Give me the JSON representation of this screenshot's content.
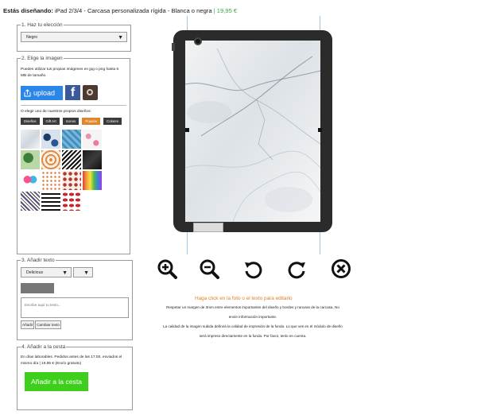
{
  "header": {
    "lead": "Estás diseñando:",
    "product": "iPad 2/3/4 - Carcasa personalizada rígida - Blanca o negra",
    "separator": "|",
    "price": "19,95 €"
  },
  "step1": {
    "legend": "1. Haz tu elección",
    "color_select": "Negro"
  },
  "step2": {
    "legend": "2. Elige la imagen",
    "upload_text": "Puedes utilizar tus propias imágenes en jpg o png hasta 6 MB de tamaño.",
    "upload_label": "upload",
    "choose_text": "O elegir uno de nuestros propios diseños:",
    "categories": [
      {
        "label": "Diseños",
        "active": false
      },
      {
        "label": "Gift Art",
        "active": false
      },
      {
        "label": "Iconos",
        "active": false
      },
      {
        "label": "Popular",
        "active": true
      },
      {
        "label": "Colores",
        "active": false
      }
    ],
    "thumbnails": [
      "marble-white",
      "blue-leaves",
      "blue-texture",
      "flamingos",
      "tropical-leaves",
      "orange-pattern",
      "chevron-black",
      "black-marble",
      "heart-watercolor",
      "speckled-dots",
      "red-pattern",
      "paint-drips",
      "zigzag-purple",
      "stripes",
      "red-lips"
    ]
  },
  "step3": {
    "legend": "3. Añadir texto",
    "font_select": "Delicious",
    "text_placeholder": "Escribe aquí tu texto...",
    "add_label": "Añadir",
    "change_label": "Cambiar texto"
  },
  "step4": {
    "legend": "4. Añadir a la cesta",
    "shipping_text": "En días laborables. Pedidos antes de las 17:00, enviados el mismo día | 19,95 € (Envío gratuito)",
    "cart_label": "Añadir a la cesta"
  },
  "editor": {
    "hint": "Haga click en la foto o el texto para editarlo",
    "info_lines": [
      "Respetar un margen de 3mm entre elementos importantes del diseño y bordes y ranuras de la carcasa. No",
      "envíe información importante.",
      "La calidad de la imagen subida definirá la calidad de impresión de la funda. Lo que ves en el módulo de diseño",
      "será impreso directamente en la funda. Por favor, tenlo en cuenta."
    ],
    "tools": [
      "zoom-in-icon",
      "zoom-out-icon",
      "rotate-left-icon",
      "rotate-right-icon",
      "delete-icon"
    ]
  },
  "colors": {
    "price": "#39a845",
    "upload": "#2c86e8",
    "active_category": "#e08528",
    "cart": "#3ecf1c",
    "hint": "#e08028"
  }
}
